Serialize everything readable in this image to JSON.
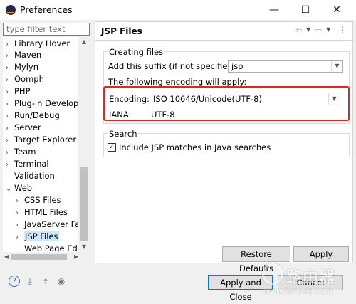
{
  "window": {
    "title": "Preferences",
    "minimize": "—",
    "maximize": "☐",
    "close": "✕"
  },
  "filter": {
    "placeholder": "type filter text"
  },
  "tree": [
    {
      "label": "Library Hover",
      "chev": "›"
    },
    {
      "label": "Maven",
      "chev": "›"
    },
    {
      "label": "Mylyn",
      "chev": "›"
    },
    {
      "label": "Oomph",
      "chev": "›"
    },
    {
      "label": "PHP",
      "chev": "›"
    },
    {
      "label": "Plug-in Developr",
      "chev": "›"
    },
    {
      "label": "Run/Debug",
      "chev": "›"
    },
    {
      "label": "Server",
      "chev": "›"
    },
    {
      "label": "Target Explorer",
      "chev": "›"
    },
    {
      "label": "Team",
      "chev": "›"
    },
    {
      "label": "Terminal",
      "chev": "›"
    },
    {
      "label": "Validation",
      "chev": ""
    },
    {
      "label": "Web",
      "chev": "⌄"
    },
    {
      "label": "CSS Files",
      "chev": "›"
    },
    {
      "label": "HTML Files",
      "chev": "›"
    },
    {
      "label": "JavaServer Fac",
      "chev": "›"
    },
    {
      "label": "JSP Files",
      "chev": "›"
    },
    {
      "label": "Web Page Edi",
      "chev": ""
    }
  ],
  "page": {
    "title": "JSP Files",
    "nav_back": "⇦",
    "nav_forward": "⇨",
    "nav_dropdown": "▼",
    "menu": "⋮",
    "creating_files": {
      "legend": "Creating files",
      "suffix_label": "Add this suffix (if not specified):",
      "suffix_value": "jsp",
      "encoding_intro": "The following encoding will apply:",
      "encoding_label": "Encoding:",
      "encoding_value": "ISO 10646/Unicode(UTF-8)",
      "iana_label": "IANA:",
      "iana_value": "UTF-8"
    },
    "search": {
      "legend": "Search",
      "checkbox_label": "Include JSP matches in Java searches",
      "checked": true,
      "check_glyph": "✓"
    },
    "restore_defaults": "Restore Defaults",
    "apply": "Apply"
  },
  "footer": {
    "apply_close": "Apply and Close",
    "cancel": "Cancel",
    "icons": {
      "help": "?",
      "import": "⤓",
      "export": "⤒",
      "record": "◉"
    }
  },
  "watermark": {
    "brand": "路由器",
    "url": "www.luyouqi.com"
  },
  "colors": {
    "highlight": "#e0261f",
    "selection": "#cce8ff",
    "default_button": "#0078d7"
  }
}
